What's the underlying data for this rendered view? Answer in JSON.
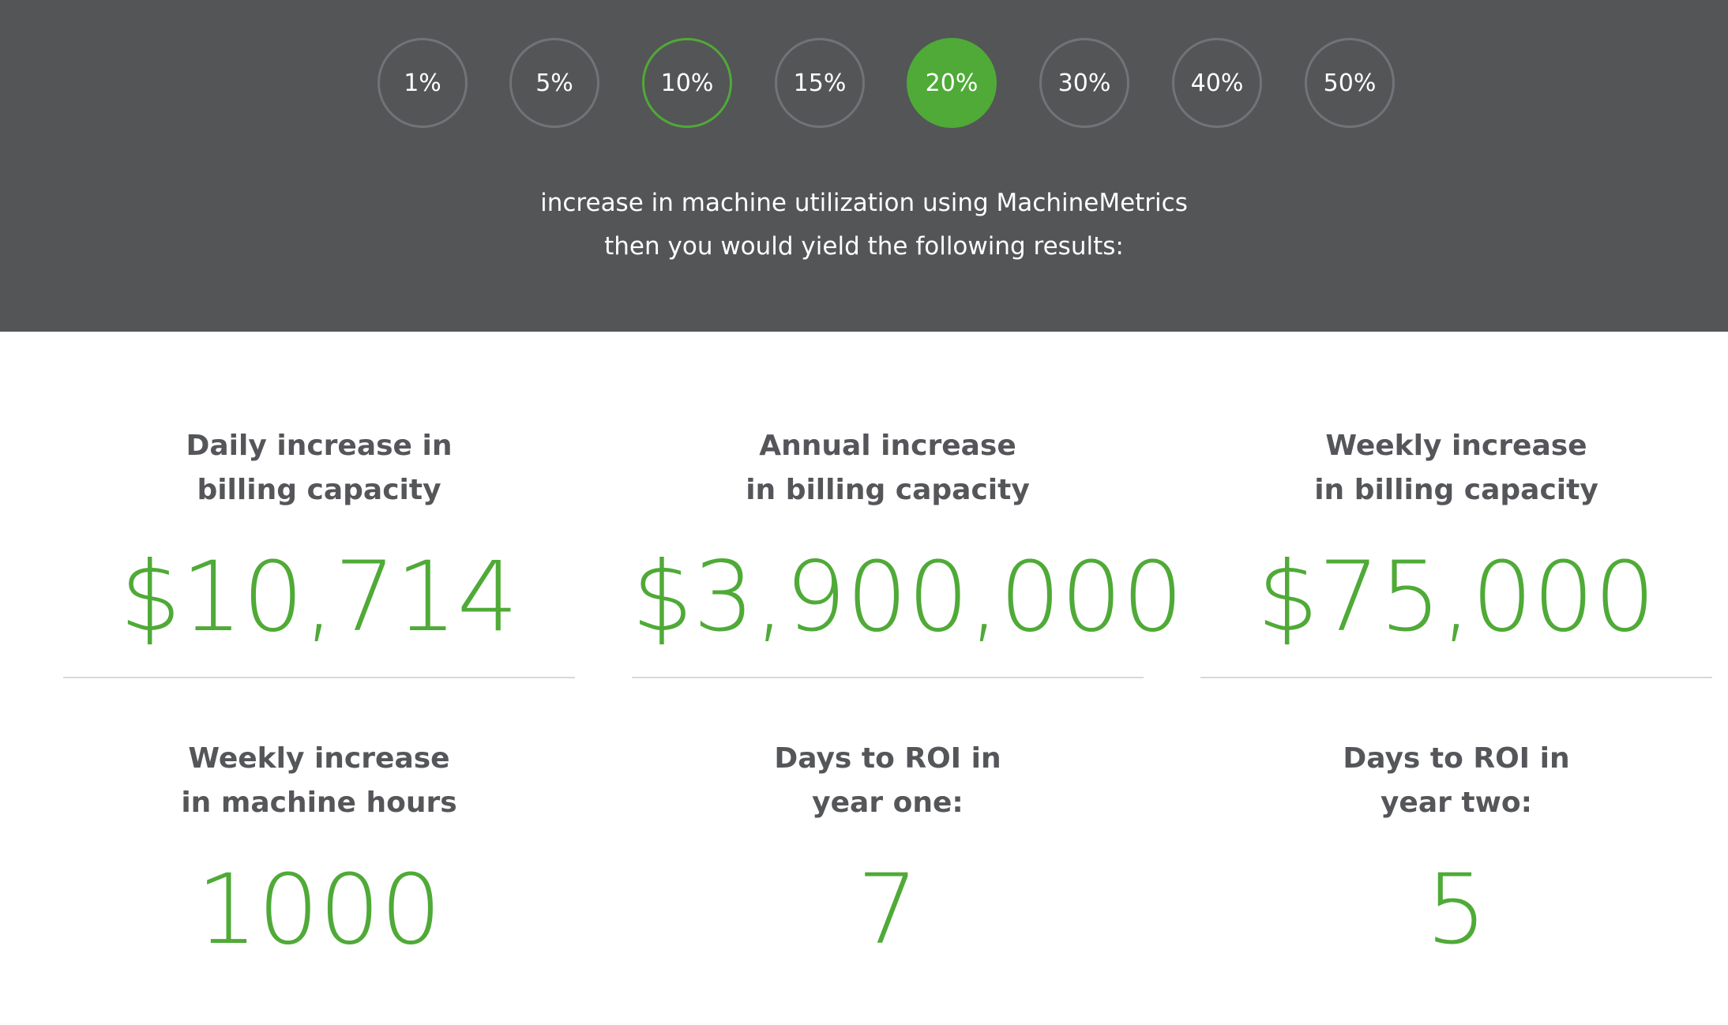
{
  "percent_options": [
    {
      "label": "1%"
    },
    {
      "label": "5%"
    },
    {
      "label": "10%"
    },
    {
      "label": "15%"
    },
    {
      "label": "20%"
    },
    {
      "label": "30%"
    },
    {
      "label": "40%"
    },
    {
      "label": "50%"
    }
  ],
  "selected_percent": "20%",
  "hovered_percent": "10%",
  "description": {
    "line1": "increase in machine utilization using MachineMetrics",
    "line2": "then you would yield the following results:"
  },
  "metrics": [
    {
      "label_line1": "Daily increase in",
      "label_line2": "billing capacity",
      "value": "$10,714"
    },
    {
      "label_line1": "Annual increase",
      "label_line2": "in billing capacity",
      "value": "$3,900,000"
    },
    {
      "label_line1": "Weekly increase",
      "label_line2": "in billing capacity",
      "value": "$75,000"
    },
    {
      "label_line1": "Weekly increase",
      "label_line2": "in machine hours",
      "value": "1000"
    },
    {
      "label_line1": "Days to ROI in",
      "label_line2": "year one:",
      "value": "7"
    },
    {
      "label_line1": "Days to ROI in",
      "label_line2": "year two:",
      "value": "5"
    }
  ],
  "colors": {
    "top_band": "#545557",
    "accent_green": "#4faa37",
    "circle_border": "#707479",
    "label_text": "#555659",
    "divider": "#d8d9db"
  }
}
